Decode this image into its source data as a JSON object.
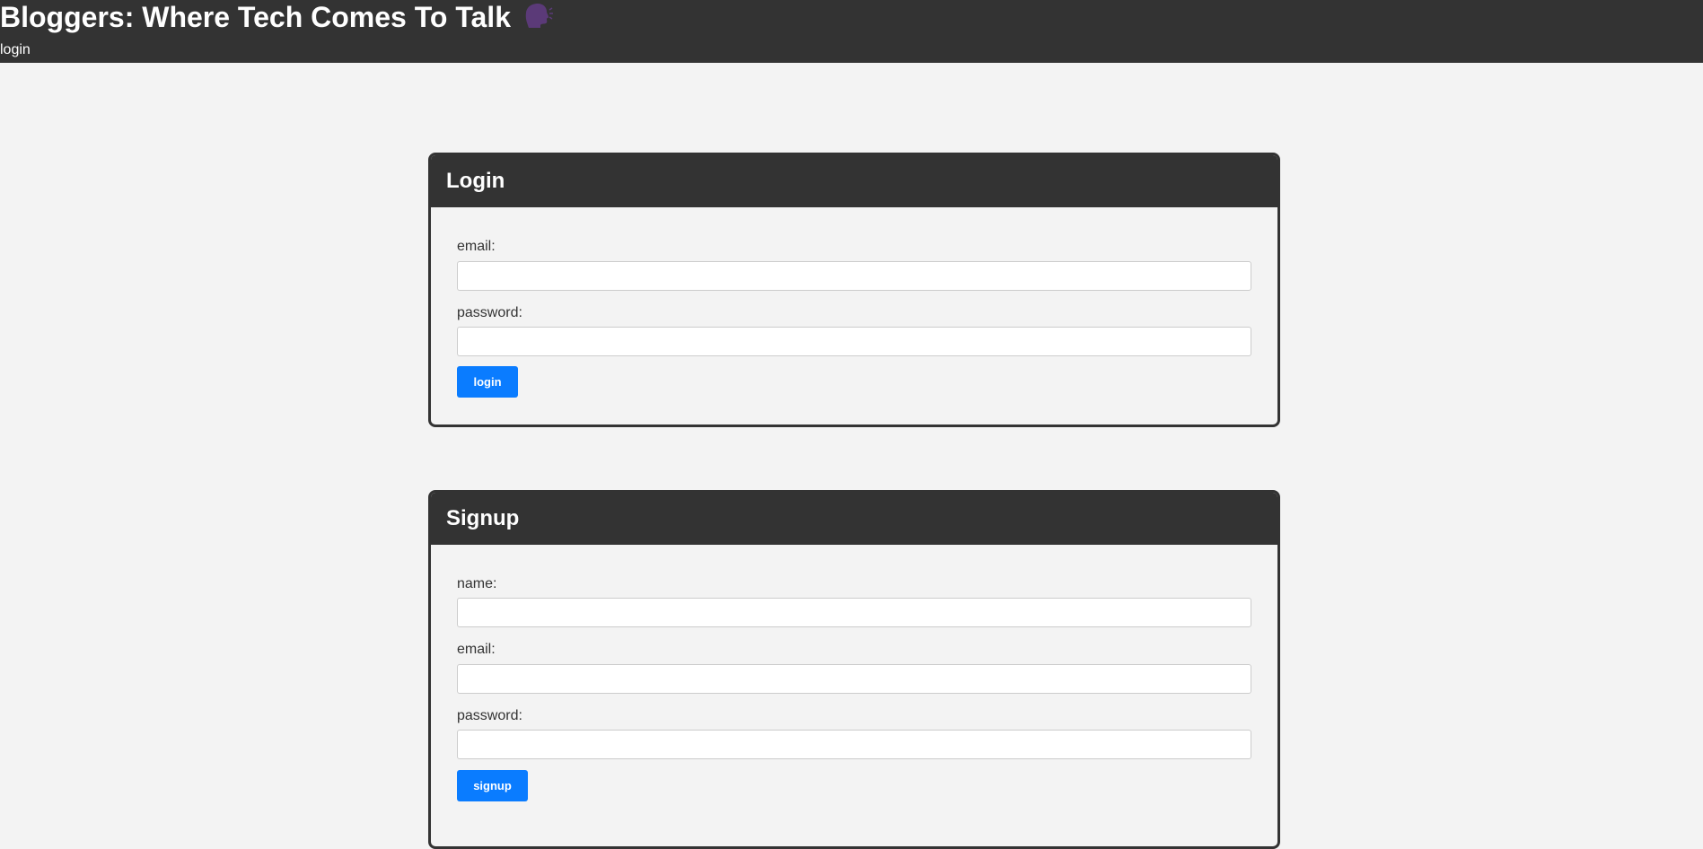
{
  "header": {
    "title": "Bloggers: Where Tech Comes To Talk",
    "icon": "speaking-head-icon",
    "nav_login": "login"
  },
  "login": {
    "title": "Login",
    "email_label": "email:",
    "email_value": "",
    "password_label": "password:",
    "password_value": "",
    "button_label": "login"
  },
  "signup": {
    "title": "Signup",
    "name_label": "name:",
    "name_value": "",
    "email_label": "email:",
    "email_value": "",
    "password_label": "password:",
    "password_value": "",
    "button_label": "signup"
  },
  "colors": {
    "header_bg": "#333333",
    "page_bg": "#f3f3f3",
    "button_bg": "#0a7cff",
    "icon": "#5b3a78"
  }
}
